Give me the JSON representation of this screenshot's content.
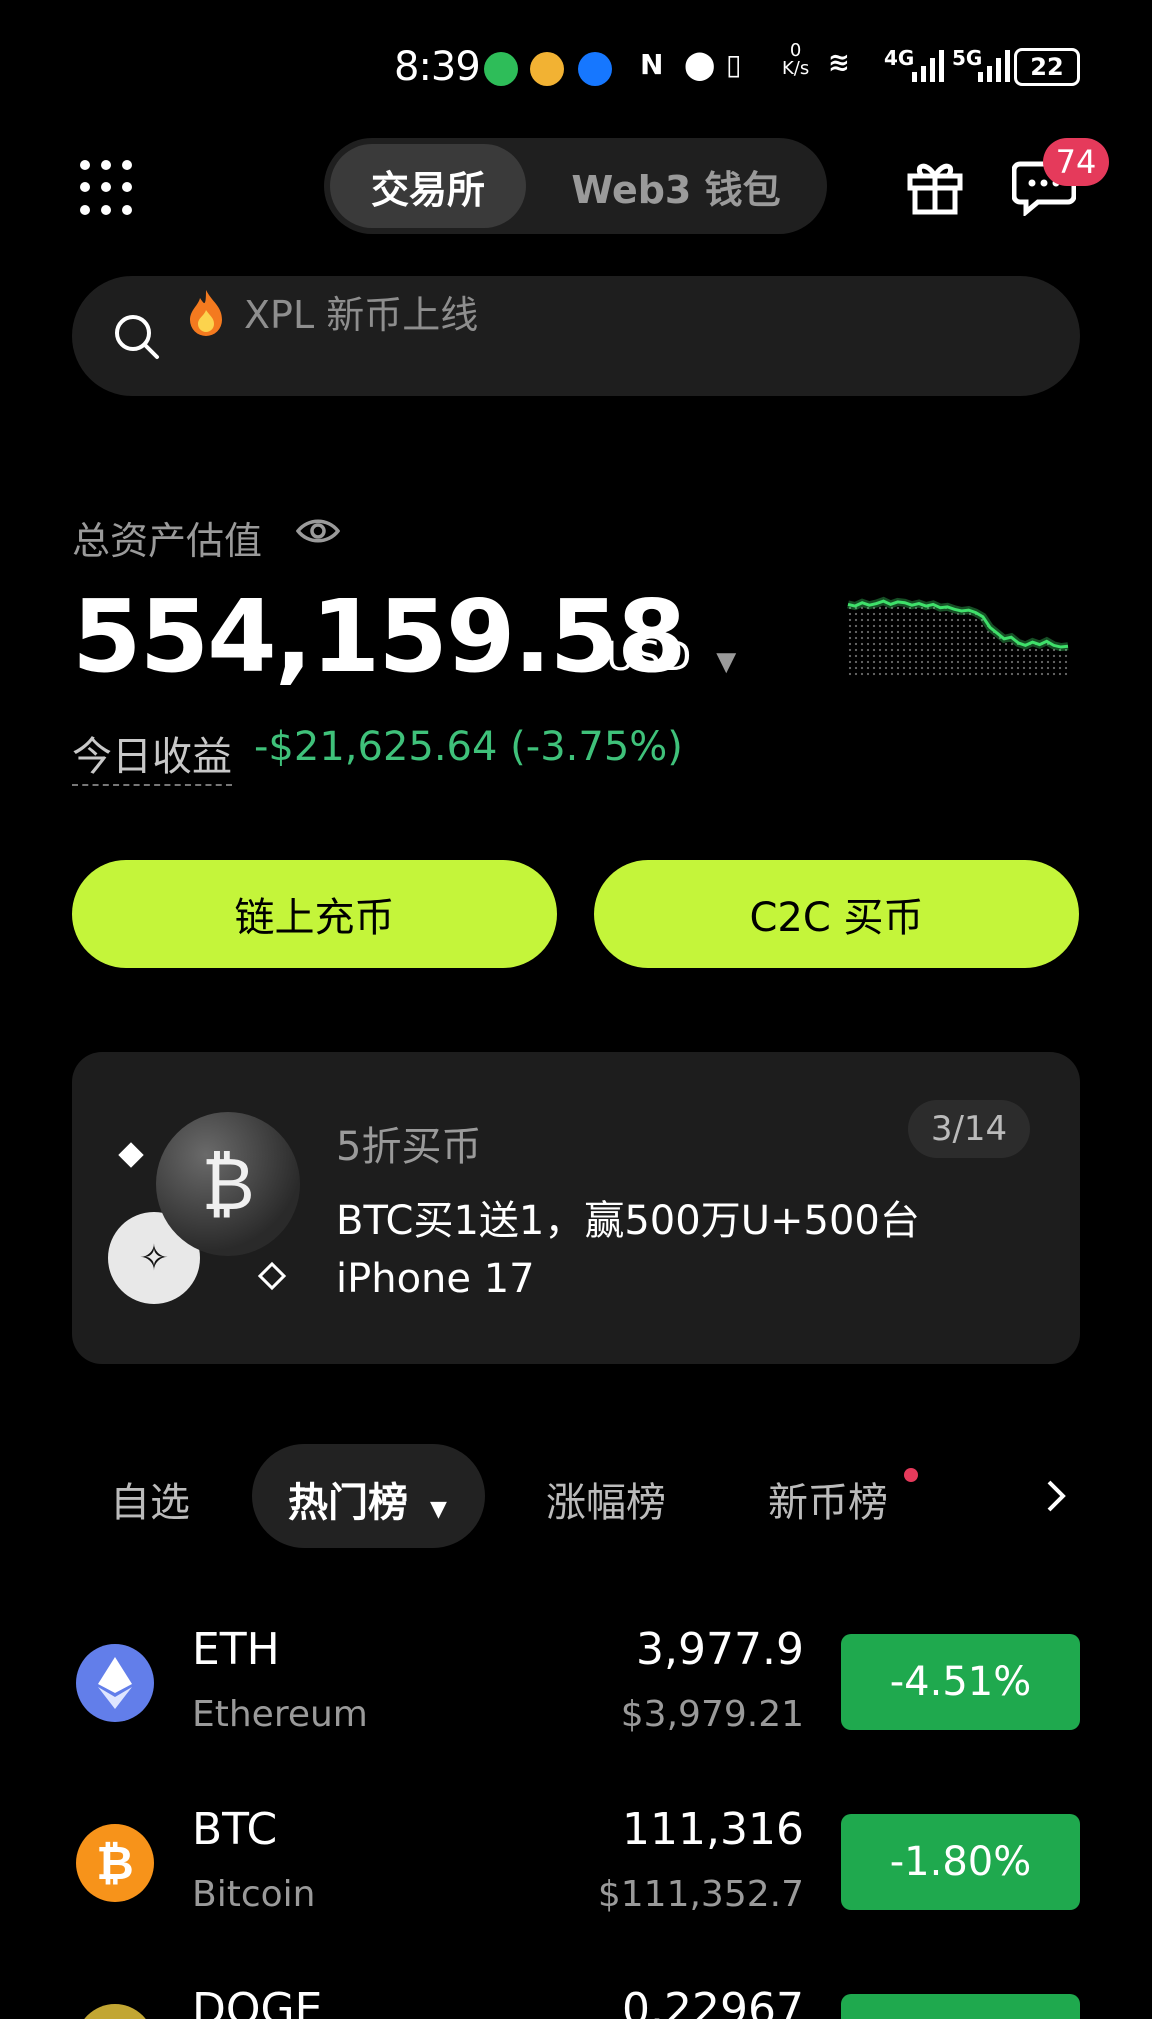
{
  "status_bar": {
    "time": "8:39",
    "net_speed_top": "0",
    "net_speed_unit": "K/s",
    "battery": "22",
    "signal_a": "4G",
    "signal_b": "5G"
  },
  "header": {
    "tabs": [
      {
        "label": "交易所",
        "active": true
      },
      {
        "label": "Web3 钱包",
        "active": false
      }
    ],
    "message_badge": "74"
  },
  "search": {
    "placeholder": "XPL 新币上线",
    "placeholder_icon": "fire-icon"
  },
  "assets": {
    "label": "总资产估值",
    "value": "554,159.58",
    "currency": "USD",
    "today_label": "今日收益",
    "today_value": "-$21,625.64 (-3.75%)",
    "trend_color": "#3fe06a",
    "sparkline": [
      0.8,
      0.78,
      0.82,
      0.79,
      0.81,
      0.84,
      0.8,
      0.83,
      0.82,
      0.79,
      0.81,
      0.78,
      0.8,
      0.76,
      0.77,
      0.74,
      0.72,
      0.73,
      0.7,
      0.65,
      0.52,
      0.45,
      0.38,
      0.4,
      0.33,
      0.3,
      0.34,
      0.31,
      0.35,
      0.3,
      0.28,
      0.29
    ]
  },
  "actions": {
    "deposit": "链上充币",
    "c2c": "C2C 买币"
  },
  "promo": {
    "subtitle": "5折买币",
    "title": "BTC买1送1，赢500万U+500台 iPhone 17",
    "counter": "3/14"
  },
  "market_tabs": [
    "自选",
    "热门榜",
    "涨幅榜",
    "新币榜"
  ],
  "coins": [
    {
      "symbol": "ETH",
      "name": "Ethereum",
      "price": "3,977.9",
      "usd": "$3,979.21",
      "change": "-4.51%",
      "icon_color": "#627eea"
    },
    {
      "symbol": "BTC",
      "name": "Bitcoin",
      "price": "111,316",
      "usd": "$111,352.7",
      "change": "-1.80%",
      "icon_color": "#f7931a"
    },
    {
      "symbol": "DOGE",
      "name": "",
      "price": "0.22967",
      "usd": "",
      "change": "",
      "icon_color": "#c2a633"
    }
  ],
  "colors": {
    "accent_lime": "#c4f53a",
    "down_green": "#1fa94e",
    "badge_red": "#e53a5b"
  }
}
